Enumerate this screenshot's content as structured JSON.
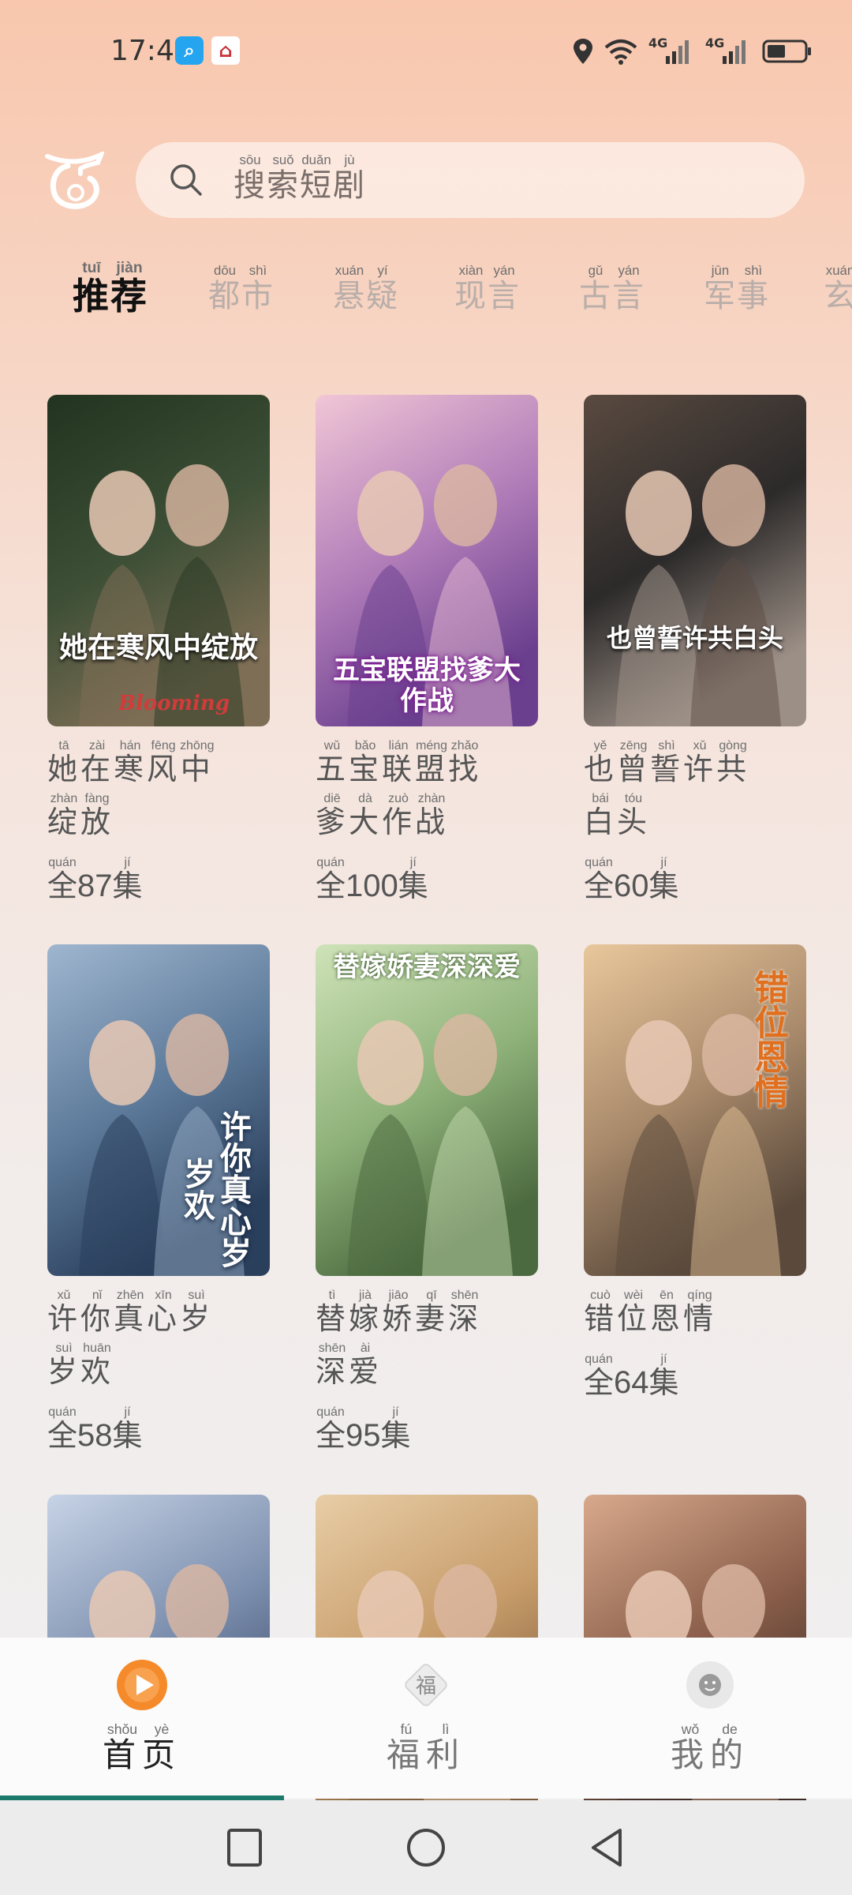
{
  "status_bar": {
    "time": "17:43",
    "network_1": "4G",
    "network_2": "4G",
    "app_icon_1": "search-app-icon",
    "app_icon_2": "store-app-icon"
  },
  "header": {
    "logo": "app-logo",
    "search_placeholder": [
      {
        "char": "搜",
        "py": "sōu"
      },
      {
        "char": "索",
        "py": "suǒ"
      },
      {
        "char": "短",
        "py": "duǎn"
      },
      {
        "char": "剧",
        "py": "jù"
      }
    ]
  },
  "tabs": [
    {
      "active": true,
      "chars": [
        {
          "char": "推",
          "py": "tuī"
        },
        {
          "char": "荐",
          "py": "jiàn"
        }
      ]
    },
    {
      "active": false,
      "chars": [
        {
          "char": "都",
          "py": "dōu"
        },
        {
          "char": "市",
          "py": "shì"
        }
      ]
    },
    {
      "active": false,
      "chars": [
        {
          "char": "悬",
          "py": "xuán"
        },
        {
          "char": "疑",
          "py": "yí"
        }
      ]
    },
    {
      "active": false,
      "chars": [
        {
          "char": "现",
          "py": "xiàn"
        },
        {
          "char": "言",
          "py": "yán"
        }
      ]
    },
    {
      "active": false,
      "chars": [
        {
          "char": "古",
          "py": "gǔ"
        },
        {
          "char": "言",
          "py": "yán"
        }
      ]
    },
    {
      "active": false,
      "chars": [
        {
          "char": "军",
          "py": "jūn"
        },
        {
          "char": "事",
          "py": "shì"
        }
      ]
    },
    {
      "active": false,
      "chars": [
        {
          "char": "玄",
          "py": "xuán"
        }
      ]
    }
  ],
  "dramas": [
    {
      "poster_text": "她在寒风中绽放",
      "poster_subtext": "Blooming",
      "title_lines": [
        [
          {
            "char": "她",
            "py": "tā"
          },
          {
            "char": "在",
            "py": "zài"
          },
          {
            "char": "寒",
            "py": "hán"
          },
          {
            "char": "风",
            "py": "fēng"
          },
          {
            "char": "中",
            "py": "zhōng"
          }
        ],
        [
          {
            "char": "绽",
            "py": "zhàn"
          },
          {
            "char": "放",
            "py": "fàng"
          }
        ]
      ],
      "count_prefix": {
        "char": "全",
        "py": "quán"
      },
      "episodes": "87",
      "count_suffix": {
        "char": "集",
        "py": "jí"
      },
      "colors": [
        "#22331f",
        "#3d4f36",
        "#7d6e55"
      ]
    },
    {
      "poster_text": "五宝联盟找爹大作战",
      "poster_subtext": "",
      "title_lines": [
        [
          {
            "char": "五",
            "py": "wǔ"
          },
          {
            "char": "宝",
            "py": "bǎo"
          },
          {
            "char": "联",
            "py": "lián"
          },
          {
            "char": "盟",
            "py": "méng"
          },
          {
            "char": "找",
            "py": "zhǎo"
          }
        ],
        [
          {
            "char": "爹",
            "py": "diē"
          },
          {
            "char": "大",
            "py": "dà"
          },
          {
            "char": "作",
            "py": "zuò"
          },
          {
            "char": "战",
            "py": "zhàn"
          }
        ]
      ],
      "count_prefix": {
        "char": "全",
        "py": "quán"
      },
      "episodes": "100",
      "count_suffix": {
        "char": "集",
        "py": "jí"
      },
      "colors": [
        "#f1c6d6",
        "#b07cb8",
        "#6a3f8e"
      ]
    },
    {
      "poster_text": "也曾誓许共白头",
      "poster_subtext": "",
      "title_lines": [
        [
          {
            "char": "也",
            "py": "yě"
          },
          {
            "char": "曾",
            "py": "zēng"
          },
          {
            "char": "誓",
            "py": "shì"
          },
          {
            "char": "许",
            "py": "xǔ"
          },
          {
            "char": "共",
            "py": "gòng"
          }
        ],
        [
          {
            "char": "白",
            "py": "bái"
          },
          {
            "char": "头",
            "py": "tóu"
          }
        ]
      ],
      "count_prefix": {
        "char": "全",
        "py": "quán"
      },
      "episodes": "60",
      "count_suffix": {
        "char": "集",
        "py": "jí"
      },
      "colors": [
        "#5a4a40",
        "#2c2a2a",
        "#9c8f86"
      ]
    },
    {
      "poster_text": "许你真心岁岁欢",
      "poster_subtext": "",
      "title_lines": [
        [
          {
            "char": "许",
            "py": "xǔ"
          },
          {
            "char": "你",
            "py": "nǐ"
          },
          {
            "char": "真",
            "py": "zhēn"
          },
          {
            "char": "心",
            "py": "xīn"
          },
          {
            "char": "岁",
            "py": "suì"
          }
        ],
        [
          {
            "char": "岁",
            "py": "suì"
          },
          {
            "char": "欢",
            "py": "huān"
          }
        ]
      ],
      "count_prefix": {
        "char": "全",
        "py": "quán"
      },
      "episodes": "58",
      "count_suffix": {
        "char": "集",
        "py": "jí"
      },
      "colors": [
        "#9fb6cf",
        "#5d7a9a",
        "#2a3f5c"
      ]
    },
    {
      "poster_text": "替嫁娇妻深深爱",
      "poster_subtext": "",
      "title_lines": [
        [
          {
            "char": "替",
            "py": "tì"
          },
          {
            "char": "嫁",
            "py": "jià"
          },
          {
            "char": "娇",
            "py": "jiāo"
          },
          {
            "char": "妻",
            "py": "qī"
          },
          {
            "char": "深",
            "py": "shēn"
          }
        ],
        [
          {
            "char": "深",
            "py": "shēn"
          },
          {
            "char": "爱",
            "py": "ài"
          }
        ]
      ],
      "count_prefix": {
        "char": "全",
        "py": "quán"
      },
      "episodes": "95",
      "count_suffix": {
        "char": "集",
        "py": "jí"
      },
      "colors": [
        "#cfe3b8",
        "#8fb27a",
        "#4c6a3f"
      ]
    },
    {
      "poster_text": "错位恩情",
      "poster_subtext": "",
      "title_lines": [
        [
          {
            "char": "错",
            "py": "cuò"
          },
          {
            "char": "位",
            "py": "wèi"
          },
          {
            "char": "恩",
            "py": "ēn"
          },
          {
            "char": "情",
            "py": "qíng"
          }
        ]
      ],
      "count_prefix": {
        "char": "全",
        "py": "quán"
      },
      "episodes": "64",
      "count_suffix": {
        "char": "集",
        "py": "jí"
      },
      "colors": [
        "#e9c79c",
        "#a98a6b",
        "#5b4a3c"
      ]
    },
    {
      "poster_text": "",
      "poster_subtext": "",
      "title_lines": [],
      "episodes": "",
      "colors": [
        "#c7d3e6",
        "#7c8fae",
        "#3a4866"
      ]
    },
    {
      "poster_text": "",
      "poster_subtext": "",
      "title_lines": [],
      "episodes": "",
      "colors": [
        "#e8cda6",
        "#c79c6a",
        "#7a5a3a"
      ]
    },
    {
      "poster_text": "",
      "poster_subtext": "",
      "title_lines": [],
      "episodes": "",
      "colors": [
        "#d8a98c",
        "#8a5e4a",
        "#3b2a24"
      ]
    }
  ],
  "bottom_nav": [
    {
      "icon": "play-icon",
      "active": true,
      "chars": [
        {
          "char": "首",
          "py": "shǒu"
        },
        {
          "char": "页",
          "py": "yè"
        }
      ]
    },
    {
      "icon": "fu-blessing-icon",
      "icon_text": "福",
      "active": false,
      "chars": [
        {
          "char": "福",
          "py": "fú"
        },
        {
          "char": "利",
          "py": "lì"
        }
      ]
    },
    {
      "icon": "profile-icon",
      "active": false,
      "chars": [
        {
          "char": "我",
          "py": "wǒ"
        },
        {
          "char": "的",
          "py": "de"
        }
      ]
    }
  ],
  "system_nav": [
    "recents-button",
    "home-button",
    "back-button"
  ],
  "colors": {
    "accent": "#f58a2a",
    "indicator": "#1c7a6d"
  }
}
